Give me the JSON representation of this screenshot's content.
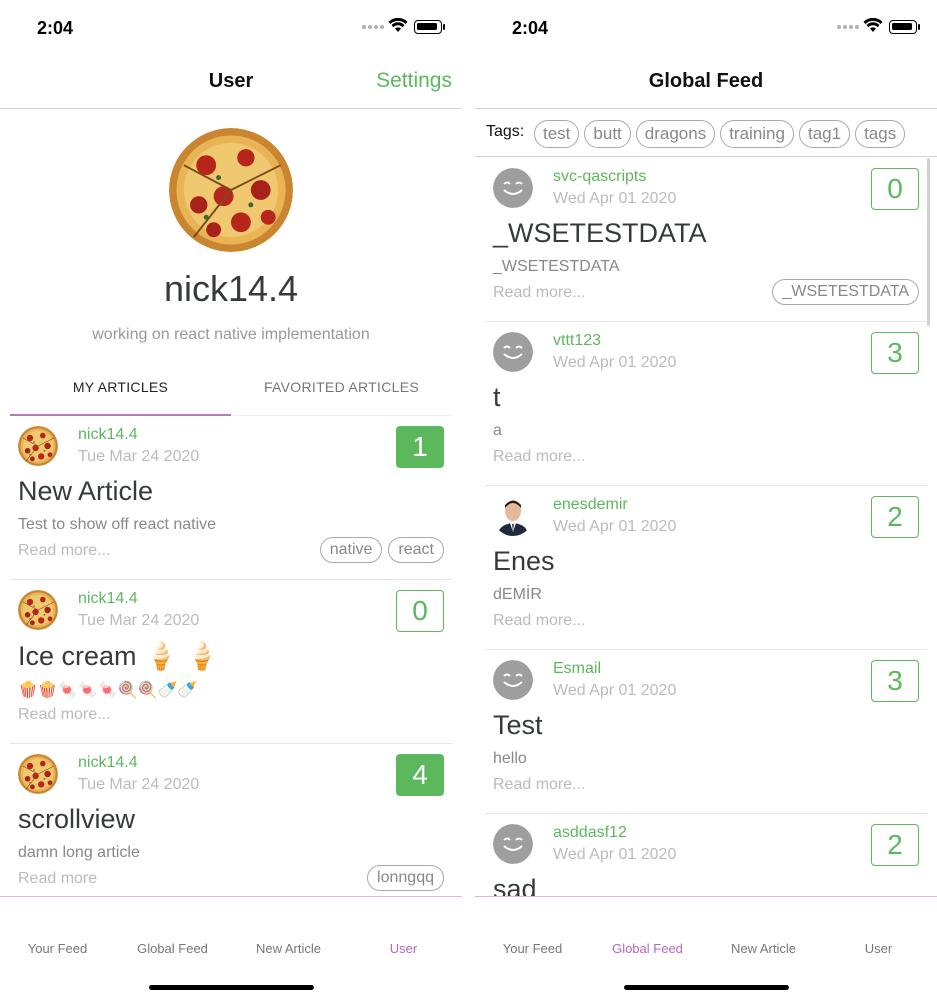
{
  "left": {
    "status": {
      "time": "2:04"
    },
    "navbar": {
      "title": "User",
      "settings": "Settings"
    },
    "profile": {
      "username": "nick14.4",
      "bio": "working on react native implementation"
    },
    "tabs": [
      {
        "label": "MY ARTICLES",
        "active": true
      },
      {
        "label": "FAVORITED ARTICLES",
        "active": false
      }
    ],
    "articles": [
      {
        "author": "nick14.4",
        "date": "Tue Mar 24 2020",
        "likes": "1",
        "filled": true,
        "title": "New Article",
        "description": "Test to show off react native",
        "read_more": "Read more...",
        "tags": [
          "native",
          "react"
        ]
      },
      {
        "author": "nick14.4",
        "date": "Tue Mar 24 2020",
        "likes": "0",
        "filled": false,
        "title": "Ice cream 🍦 🍦",
        "description": "🍿🍿🍬🍬🍬🍭🍭🍼🍼",
        "read_more": "Read more...",
        "tags": []
      },
      {
        "author": "nick14.4",
        "date": "Tue Mar 24 2020",
        "likes": "4",
        "filled": true,
        "title": "scrollview",
        "description": "damn long article",
        "read_more": "Read more",
        "tags": [
          "lonngqq"
        ]
      }
    ],
    "tabbar": [
      {
        "label": "Your Feed",
        "active": false
      },
      {
        "label": "Global Feed",
        "active": false
      },
      {
        "label": "New Article",
        "active": false
      },
      {
        "label": "User",
        "active": true
      }
    ]
  },
  "right": {
    "status": {
      "time": "2:04"
    },
    "navbar": {
      "title": "Global Feed"
    },
    "tags_label": "Tags:",
    "tags": [
      "test",
      "butt",
      "dragons",
      "training",
      "tag1",
      "tags"
    ],
    "articles": [
      {
        "author": "svc-qascripts",
        "date": "Wed Apr 01 2020",
        "likes": "0",
        "avatar": "smiley",
        "title": "_WSETESTDATA",
        "description": "_WSETESTDATA",
        "read_more": "Read more...",
        "tags": [
          "_WSETESTDATA"
        ]
      },
      {
        "author": "vttt123",
        "date": "Wed Apr 01 2020",
        "likes": "3",
        "avatar": "smiley",
        "title": "t",
        "description": "a",
        "read_more": "Read more...",
        "tags": []
      },
      {
        "author": "enesdemir",
        "date": "Wed Apr 01 2020",
        "likes": "2",
        "avatar": "person-photo",
        "title": "Enes",
        "description": "dEMİR",
        "read_more": "Read more...",
        "tags": []
      },
      {
        "author": "Esmail",
        "date": "Wed Apr 01 2020",
        "likes": "3",
        "avatar": "smiley",
        "title": "Test",
        "description": "hello",
        "read_more": "Read more...",
        "tags": []
      },
      {
        "author": "asddasf12",
        "date": "Wed Apr 01 2020",
        "likes": "2",
        "avatar": "smiley",
        "title": "sad",
        "description": "",
        "read_more": "",
        "tags": []
      }
    ],
    "tabbar": [
      {
        "label": "Your Feed",
        "active": false
      },
      {
        "label": "Global Feed",
        "active": true
      },
      {
        "label": "New Article",
        "active": false
      },
      {
        "label": "User",
        "active": false
      }
    ]
  },
  "colors": {
    "accent_green": "#5cb85c",
    "accent_purple": "#b569b8",
    "muted": "#bbbbbb"
  }
}
